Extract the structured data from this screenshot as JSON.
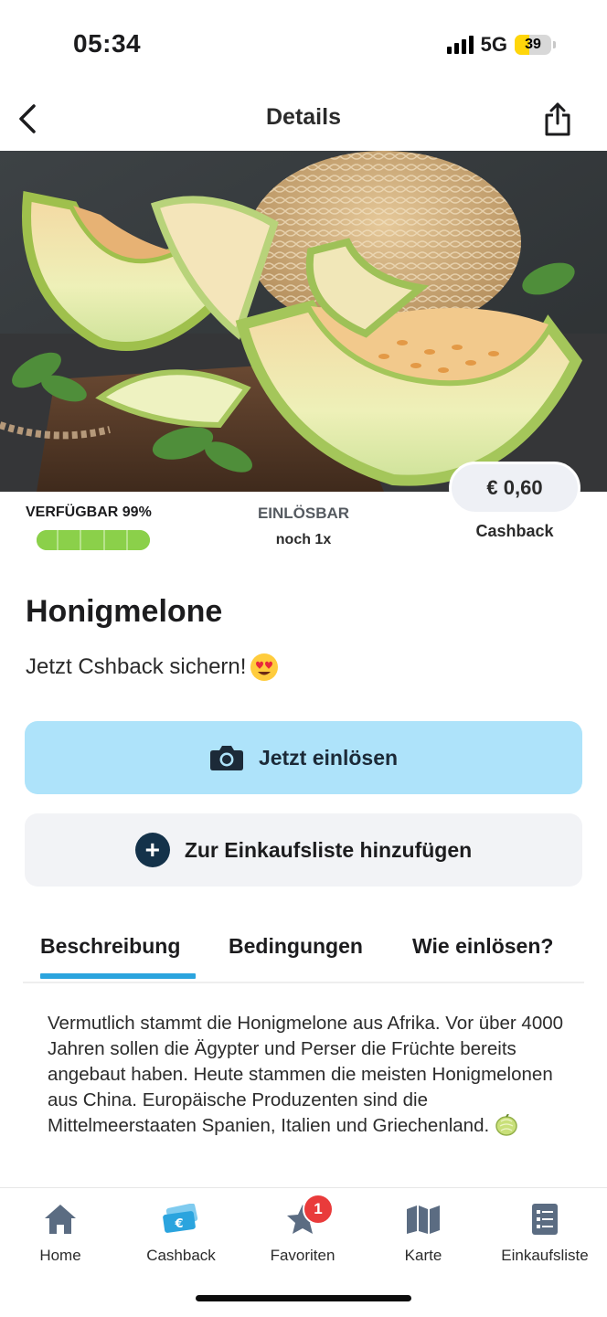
{
  "status_bar": {
    "time": "05:34",
    "network": "5G",
    "battery_level": "39",
    "battery_color": "#ffd60a"
  },
  "header": {
    "title": "Details",
    "back_icon": "chevron-left-icon",
    "share_icon": "share-icon"
  },
  "hero": {
    "image_subject": "honeydew melon slices with mint leaves"
  },
  "stats": {
    "availability_label": "VERFÜGBAR 99%",
    "availability_fraction": 0.99,
    "availability_color": "#8bd04a",
    "redeemable_label": "EINLÖSBAR",
    "redeemable_value": "noch 1x",
    "cashback_amount": "€ 0,60",
    "cashback_label": "Cashback"
  },
  "product": {
    "title": "Honigmelone",
    "subtitle": "Jetzt Cshback sichern!",
    "subtitle_emoji": "heart-eyes-emoji"
  },
  "actions": {
    "redeem_label": "Jetzt einlösen",
    "redeem_icon": "camera-icon",
    "redeem_color": "#aee3fa",
    "add_list_label": "Zur Einkaufsliste hinzufügen",
    "add_list_icon": "plus-circle-icon"
  },
  "tabs": [
    {
      "label": "Beschreibung",
      "active": true
    },
    {
      "label": "Bedingungen",
      "active": false
    },
    {
      "label": "Wie einlösen?",
      "active": false
    }
  ],
  "accent_color": "#2ba4de",
  "description": "Vermutlich stammt die Honigmelone aus Afrika. Vor über 4000 Jahren sollen die Ägypter und Perser die Früchte bereits angebaut haben. Heute stammen die meisten Honigmelonen aus China. Europäische Produzenten sind die Mittelmeerstaaten Spanien, Italien und Griechenland.",
  "bottom_nav": [
    {
      "label": "Home",
      "icon": "home-icon",
      "color": "#5b6c82"
    },
    {
      "label": "Cashback",
      "icon": "cashback-euro-icon",
      "color": "#2ba4de"
    },
    {
      "label": "Favoriten",
      "icon": "star-icon",
      "badge": "1",
      "color": "#5b6c82"
    },
    {
      "label": "Karte",
      "icon": "map-icon",
      "color": "#5b6c82"
    },
    {
      "label": "Einkaufsliste",
      "icon": "checklist-icon",
      "color": "#5b6c82"
    }
  ]
}
